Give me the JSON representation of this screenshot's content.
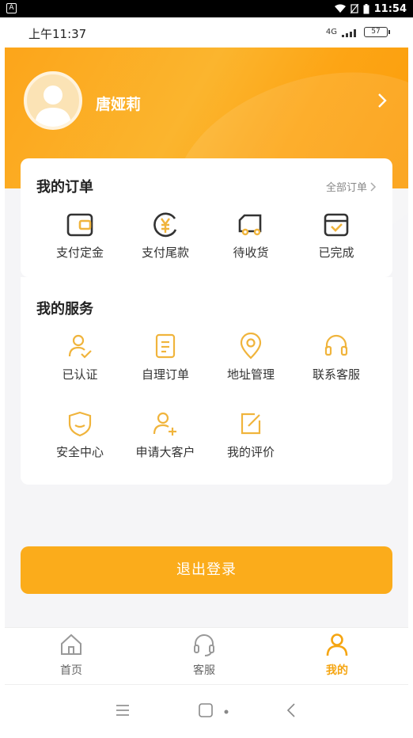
{
  "system": {
    "time": "11:54"
  },
  "status": {
    "time": "上午11:37",
    "network": "4G",
    "battery": "57"
  },
  "profile": {
    "name": "唐娅莉"
  },
  "orders": {
    "title": "我的订单",
    "all_label": "全部订单",
    "items": [
      {
        "label": "支付定金",
        "icon": "wallet-icon"
      },
      {
        "label": "支付尾款",
        "icon": "yen-icon"
      },
      {
        "label": "待收货",
        "icon": "truck-icon"
      },
      {
        "label": "已完成",
        "icon": "box-check-icon"
      }
    ]
  },
  "services": {
    "title": "我的服务",
    "items": [
      {
        "label": "已认证",
        "icon": "verified-user-icon"
      },
      {
        "label": "自理订单",
        "icon": "document-icon"
      },
      {
        "label": "地址管理",
        "icon": "location-icon"
      },
      {
        "label": "联系客服",
        "icon": "headset-icon"
      },
      {
        "label": "安全中心",
        "icon": "shield-icon"
      },
      {
        "label": "申请大客户",
        "icon": "add-user-icon"
      },
      {
        "label": "我的评价",
        "icon": "edit-icon"
      }
    ]
  },
  "logout_label": "退出登录",
  "tabs": [
    {
      "label": "首页",
      "icon": "home-icon"
    },
    {
      "label": "客服",
      "icon": "headset-icon"
    },
    {
      "label": "我的",
      "icon": "user-icon"
    }
  ],
  "colors": {
    "accent": "#fbac1b",
    "icon_gold": "#f0b43c"
  }
}
